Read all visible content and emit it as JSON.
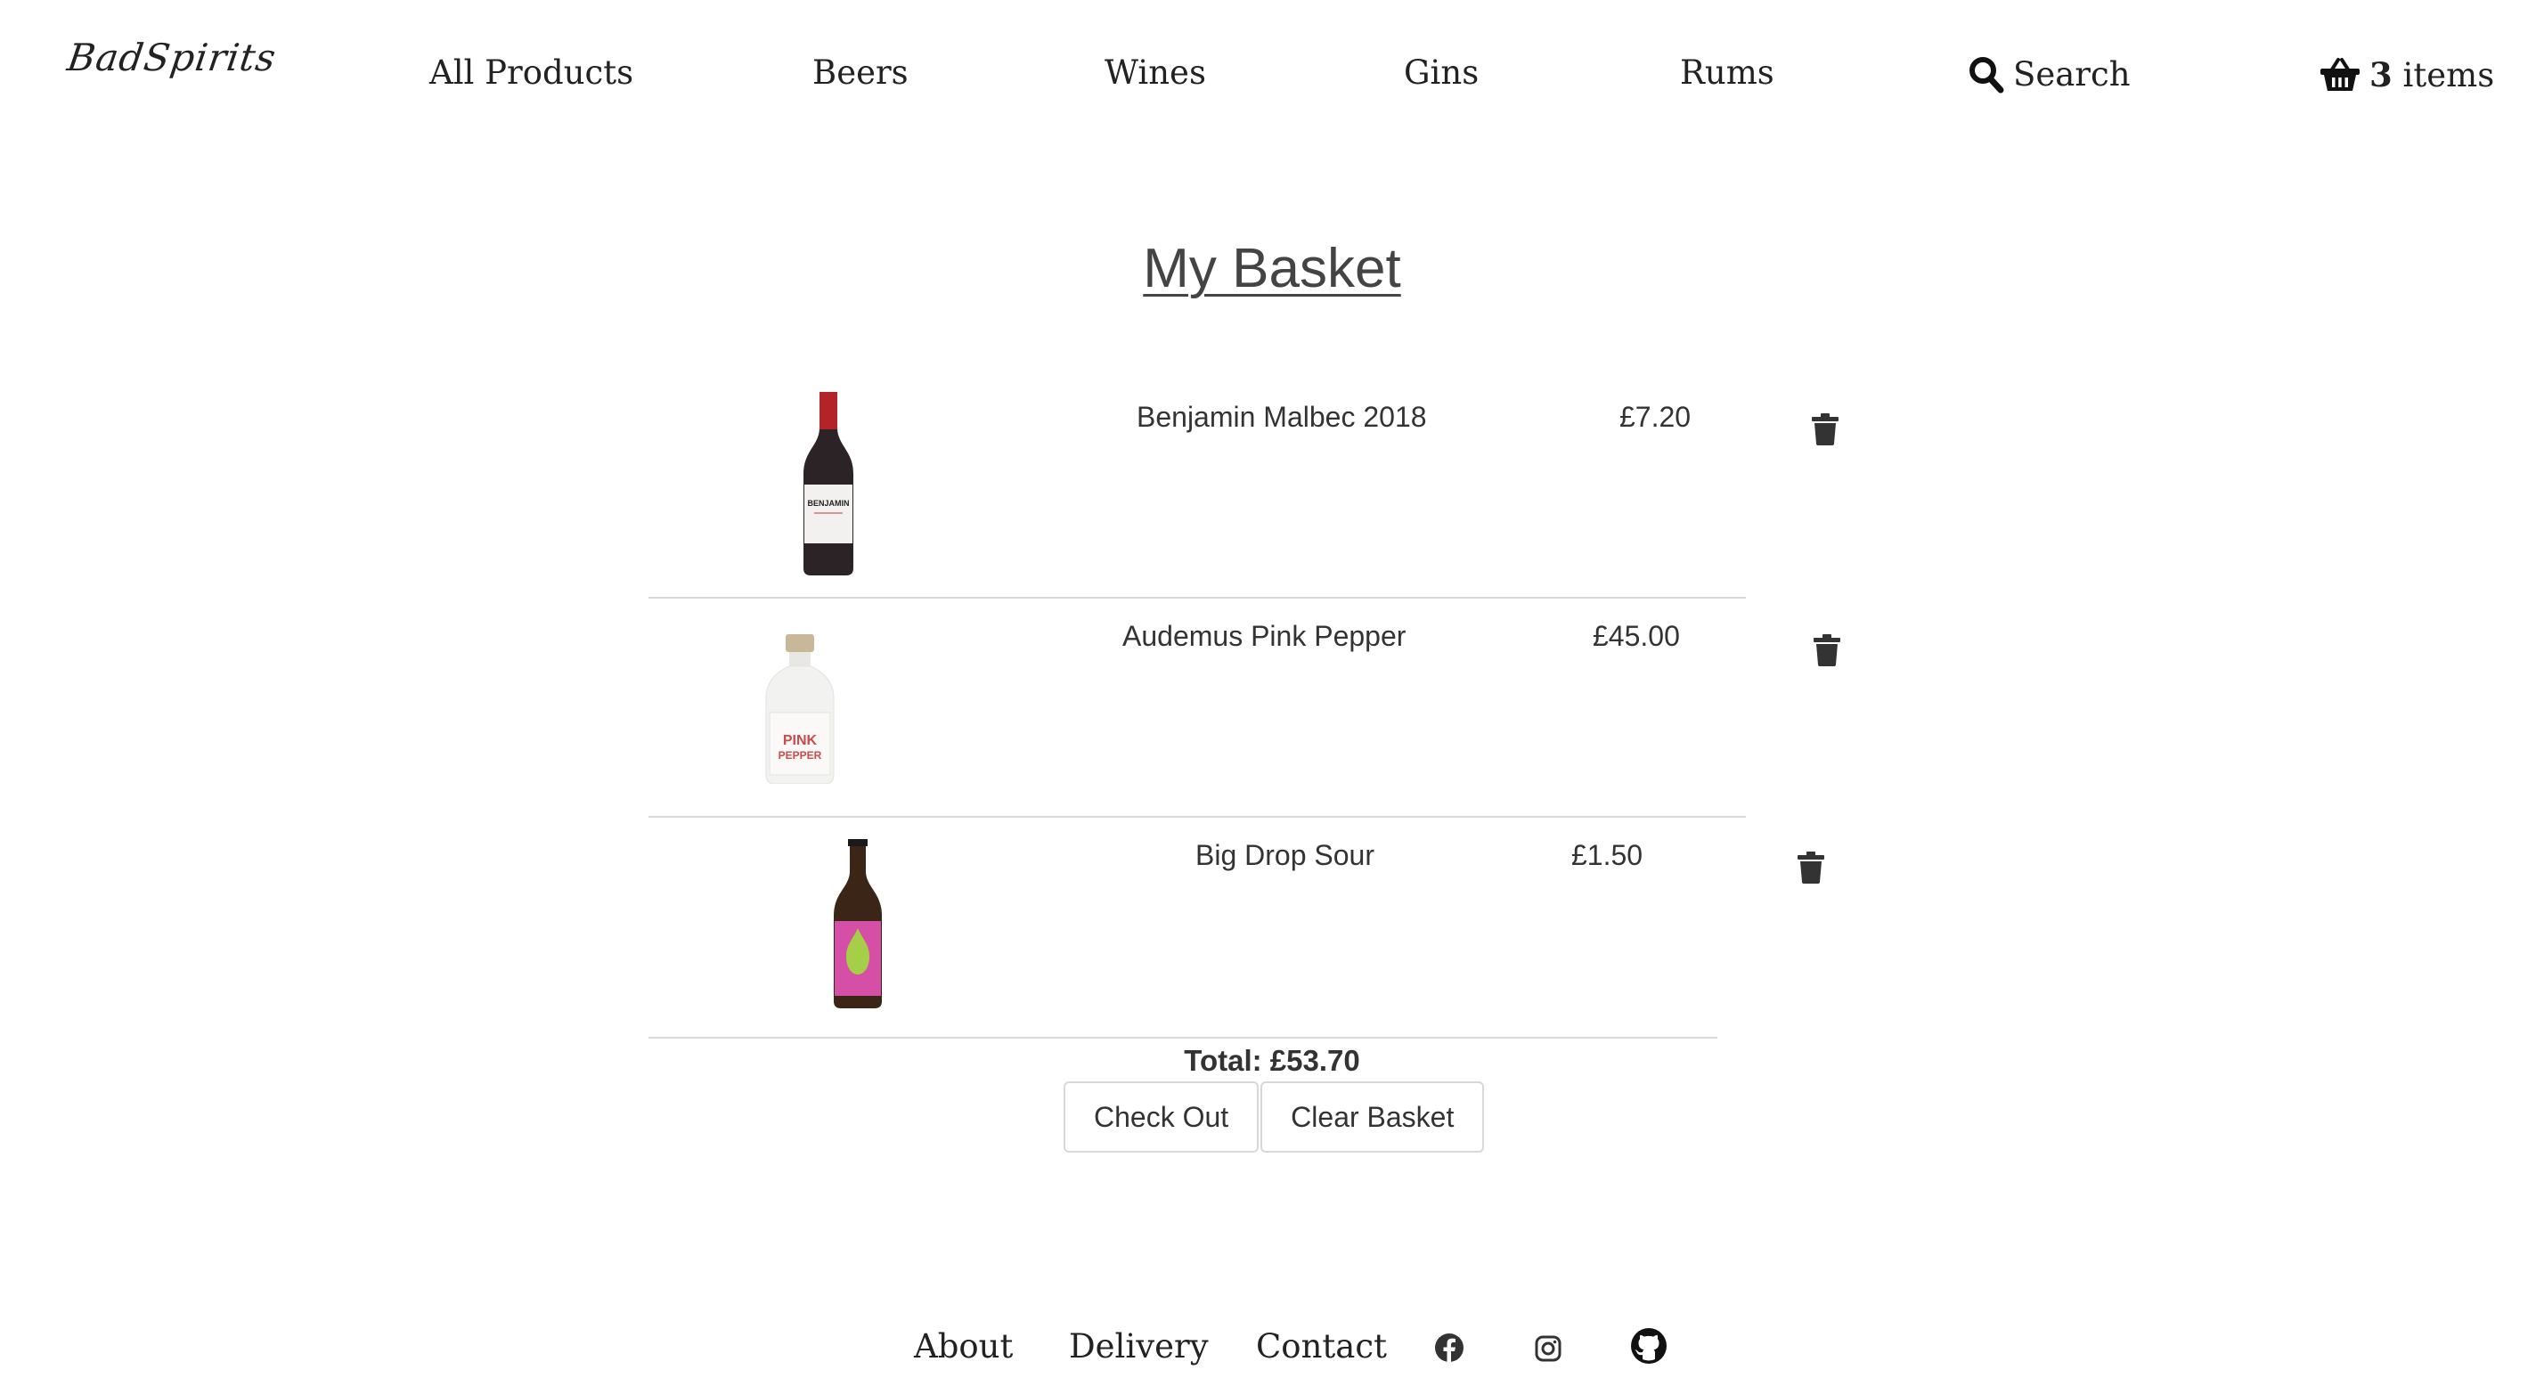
{
  "header": {
    "logo_text": "BadSpirits",
    "nav": {
      "all_products": "All Products",
      "beers": "Beers",
      "wines": "Wines",
      "gins": "Gins",
      "rums": "Rums",
      "search": "Search"
    },
    "basket": {
      "count": "3",
      "label": "items"
    }
  },
  "main": {
    "title": "My Basket",
    "items": [
      {
        "name": "Benjamin Malbec 2018",
        "price": "£7.20",
        "image_label": "BENJAMIN",
        "icon": "trash-icon"
      },
      {
        "name": "Audemus Pink Pepper",
        "price": "£45.00",
        "image_label": "PINK PEPPER",
        "icon": "trash-icon"
      },
      {
        "name": "Big Drop Sour",
        "price": "£1.50",
        "icon": "trash-icon"
      }
    ],
    "total": "Total: £53.70",
    "buttons": {
      "checkout": "Check Out",
      "clear": "Clear Basket"
    }
  },
  "footer": {
    "links": {
      "about": "About",
      "delivery": "Delivery",
      "contact": "Contact"
    },
    "icons": [
      "facebook-icon",
      "instagram-icon",
      "github-icon"
    ]
  },
  "colors": {
    "text": "#333333",
    "divider": "#d9d9d9",
    "wine_cap": "#b3232a",
    "beer_label": "#d64fa6",
    "beer_pear": "#a6cf48"
  }
}
